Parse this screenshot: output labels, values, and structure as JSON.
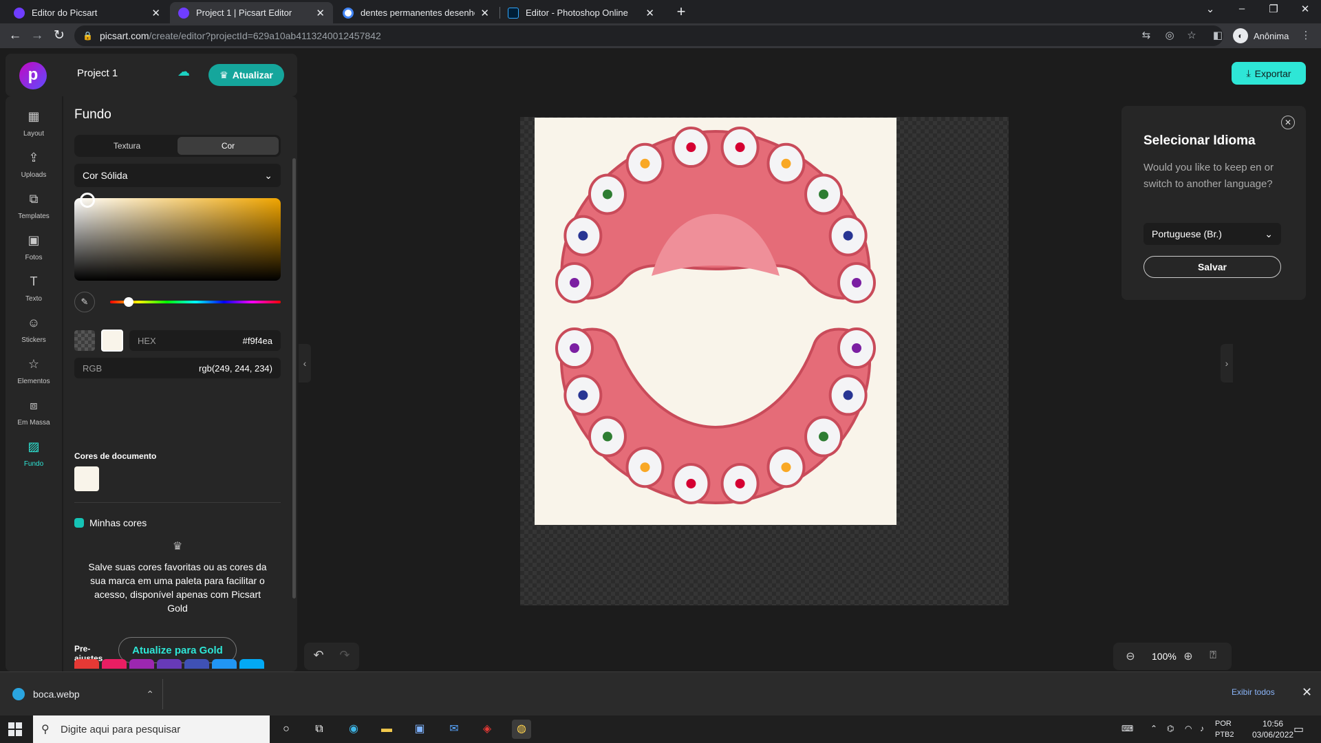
{
  "browser": {
    "tabs": [
      {
        "title": "Editor do Picsart",
        "icon": "picsart-icon",
        "color": "#6f3dff"
      },
      {
        "title": "Project 1 | Picsart Editor",
        "icon": "picsart-icon",
        "color": "#6f3dff"
      },
      {
        "title": "dentes permanentes desenho pr…",
        "icon": "google-icon",
        "color": "#4285f4"
      },
      {
        "title": "Editor - Photoshop Online",
        "icon": "photoshop-icon",
        "color": "#31a8ff"
      }
    ],
    "active_tab": 1,
    "url_host": "picsart.com",
    "url_path": "/create/editor?projectId=629a10ab4113240012457842",
    "profile_label": "Anônima"
  },
  "editor": {
    "project_name": "Project 1",
    "upgrade_label": "Atualizar",
    "export_label": "Exportar",
    "sidebar": [
      {
        "label": "Layout",
        "icon": "layout-icon",
        "glyph": "▦"
      },
      {
        "label": "Uploads",
        "icon": "upload-icon",
        "glyph": "⇪"
      },
      {
        "label": "Templates",
        "icon": "templates-icon",
        "glyph": "⧉"
      },
      {
        "label": "Fotos",
        "icon": "photo-icon",
        "glyph": "▣"
      },
      {
        "label": "Texto",
        "icon": "text-icon",
        "glyph": "T"
      },
      {
        "label": "Stickers",
        "icon": "sticker-icon",
        "glyph": "☺"
      },
      {
        "label": "Elementos",
        "icon": "star-icon",
        "glyph": "☆"
      },
      {
        "label": "Em Massa",
        "icon": "batch-icon",
        "glyph": "⧈"
      },
      {
        "label": "Fundo",
        "icon": "background-icon",
        "glyph": "▨"
      }
    ],
    "active_sidebar": 8,
    "panel": {
      "title": "Fundo",
      "segments": [
        "Textura",
        "Cor"
      ],
      "active_segment": 1,
      "fill_type": "Cor Sólida",
      "hex_label": "HEX",
      "hex_value": "#f9f4ea",
      "rgb_label": "RGB",
      "rgb_value": "rgb(249, 244, 234)",
      "doc_colors_title": "Cores de documento",
      "doc_color": "#f9f4ea",
      "my_colors_title": "Minhas cores",
      "gold_text": "Salve suas cores favoritas ou as cores da sua marca em uma paleta para facilitar o acesso, disponível apenas com Picsart Gold",
      "gold_button": "Atualize para Gold",
      "presets_title": "Pre-ajustes",
      "presets": [
        "#e53935",
        "#e91e63",
        "#9c27b0",
        "#673ab7",
        "#3f51b5",
        "#2196f3",
        "#03a9f4"
      ]
    },
    "zoom": "100%",
    "language_popup": {
      "title": "Selecionar Idioma",
      "body": "Would you like to keep en or switch to another language?",
      "selected": "Portuguese (Br.)",
      "save": "Salvar"
    }
  },
  "downloads": {
    "file": "boca.webp",
    "show_all": "Exibir todos"
  },
  "taskbar": {
    "search_placeholder": "Digite aqui para pesquisar",
    "lang_line1": "POR",
    "lang_line2": "PTB2",
    "time": "10:56",
    "date": "03/06/2022"
  }
}
